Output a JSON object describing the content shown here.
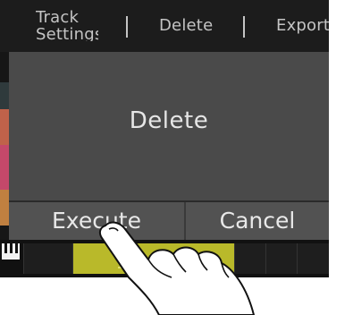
{
  "menu": {
    "track_settings_line1": "Track",
    "track_settings_line2": "Settings",
    "delete_label": "Delete",
    "export_label": "Export"
  },
  "dialog": {
    "title": "Delete",
    "execute_label": "Execute",
    "cancel_label": "Cancel"
  },
  "colors": {
    "screen_bg": "#161616",
    "dialog_bg": "#4a4a4a",
    "active_cell": "#b9b92a",
    "track_colors": [
      "#2f3a3c",
      "#c0624a",
      "#c4486a",
      "#c08040"
    ]
  },
  "icons": {
    "keyboard": "piano-keyboard-icon",
    "pointer": "hand-pointer-icon"
  }
}
